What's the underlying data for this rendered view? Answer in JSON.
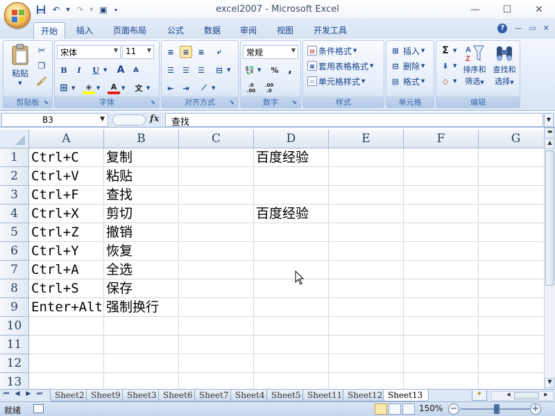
{
  "window": {
    "title": "excel2007 - Microsoft Excel",
    "controls": [
      "—",
      "☐",
      "✕"
    ]
  },
  "tabs": [
    {
      "label": "开始",
      "active": true
    },
    {
      "label": "插入"
    },
    {
      "label": "页面布局"
    },
    {
      "label": "公式"
    },
    {
      "label": "数据"
    },
    {
      "label": "审阅"
    },
    {
      "label": "视图"
    },
    {
      "label": "开发工具"
    }
  ],
  "ribbon": {
    "clipboard": {
      "label": "剪贴板",
      "paste": "粘贴"
    },
    "font": {
      "label": "字体",
      "name": "宋体",
      "size": "11",
      "bold": "B",
      "italic": "I",
      "underline": "U",
      "grow": "A",
      "shrink": "A",
      "fontcolor": "A",
      "wen": "文"
    },
    "alignment": {
      "label": "对齐方式"
    },
    "number": {
      "label": "数字",
      "format": "常规",
      "percent": "%",
      "comma": ",",
      "inc": ".0 .00",
      "dec": ".00 .0"
    },
    "styles": {
      "label": "样式",
      "conditional": "条件格式",
      "table": "套用表格格式",
      "cell": "单元格样式"
    },
    "cells": {
      "label": "单元格",
      "insert": "插入",
      "delete": "删除",
      "format": "格式"
    },
    "editing": {
      "label": "编辑",
      "sort": "排序和",
      "sort2": "筛选",
      "find": "查找和",
      "find2": "选择",
      "sigma": "Σ"
    }
  },
  "formula_bar": {
    "name_box": "B3",
    "fx": "fx",
    "content": "查找"
  },
  "grid": {
    "columns": [
      "A",
      "B",
      "C",
      "D",
      "E",
      "F",
      "G"
    ],
    "rows": [
      {
        "num": "1",
        "A": "Ctrl+C",
        "B": "复制",
        "D": "百度经验"
      },
      {
        "num": "2",
        "A": "Ctrl+V",
        "B": "粘贴",
        "D": ""
      },
      {
        "num": "3",
        "A": "Ctrl+F",
        "B": "查找",
        "D": ""
      },
      {
        "num": "4",
        "A": "Ctrl+X",
        "B": "剪切",
        "D": "百度经验"
      },
      {
        "num": "5",
        "A": "Ctrl+Z",
        "B": "撤销",
        "D": ""
      },
      {
        "num": "6",
        "A": "Ctrl+Y",
        "B": "恢复",
        "D": ""
      },
      {
        "num": "7",
        "A": "Ctrl+A",
        "B": "全选",
        "D": ""
      },
      {
        "num": "8",
        "A": "Ctrl+S",
        "B": "保存",
        "D": ""
      },
      {
        "num": "9",
        "A": "Enter+Alt",
        "B": "强制换行",
        "D": ""
      },
      {
        "num": "10",
        "A": "",
        "B": "",
        "D": ""
      },
      {
        "num": "11",
        "A": "",
        "B": "",
        "D": ""
      },
      {
        "num": "12",
        "A": "",
        "B": "",
        "D": ""
      },
      {
        "num": "13",
        "A": "",
        "B": "",
        "D": ""
      }
    ]
  },
  "sheets": [
    "Sheet2",
    "Sheet9",
    "Sheet3",
    "Sheet6",
    "Sheet7",
    "Sheet4",
    "Sheet5",
    "Sheet11",
    "Sheet12",
    "Sheet13"
  ],
  "active_sheet": "Sheet13",
  "status": {
    "mode": "就绪",
    "zoom": "150%",
    "zoom_minus": "−",
    "zoom_plus": "+"
  }
}
